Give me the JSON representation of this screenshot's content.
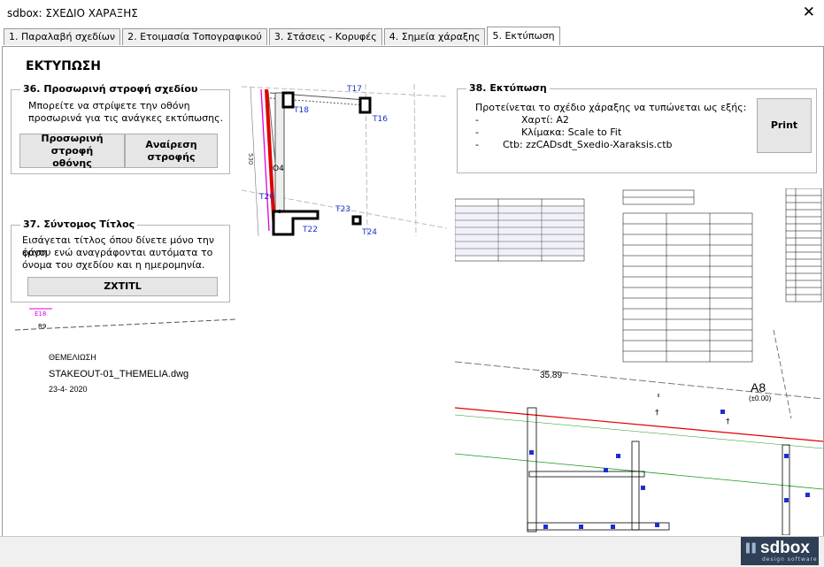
{
  "window": {
    "title": "sdbox:  ΣΧΕΔΙΟ  ΧΑΡΑΞΗΣ",
    "close_glyph": "✕"
  },
  "tabs": [
    {
      "label": "1. Παραλαβή σχεδίων"
    },
    {
      "label": "2. Ετοιμασία Τοπογραφικού"
    },
    {
      "label": "3. Στάσεις - Κορυφές"
    },
    {
      "label": "4. Σημεία χάραξης"
    },
    {
      "label": "5. Εκτύπωση"
    }
  ],
  "active_tab": 4,
  "page": {
    "heading": "ΕΚΤΥΠΩΣΗ"
  },
  "section36": {
    "title": "36. Προσωρινή στροφή σχεδίου",
    "line1": "Μπορείτε να στρίψετε την οθόνη",
    "line2": "προσωρινά για τις ανάγκες εκτύπωσης.",
    "rotate_btn_line1": "Προσωρινή στροφή",
    "rotate_btn_line2": "οθόνης",
    "undo_btn_line1": "Αναίρεση",
    "undo_btn_line2": "στροφής"
  },
  "section37": {
    "title": "37. Σύντομος Τίτλος",
    "line1": "Εισάγεται τίτλος όπου δίνετε μόνο την φάση",
    "line2": "έργου ενώ αναγράφονται αυτόματα το",
    "line3": "όνομα του σχεδίου και η ημερομηνία.",
    "btn": "ZXTITL"
  },
  "section38": {
    "title": "38. Εκτύπωση",
    "intro": "Προτείνεται το σχέδιο χάραξης να τυπώνεται ως εξής:",
    "rows": [
      {
        "dash": "-",
        "text": "Χαρτί: A2"
      },
      {
        "dash": "-",
        "text": "Κλίμακα: Scale to Fit"
      },
      {
        "dash": "-",
        "text": "Ctb: zzCADsdt_Sxedio-Xaraksis.ctb"
      }
    ],
    "print_btn": "Print"
  },
  "stamp": {
    "phase": "ΘΕΜΕΛΙΩΣΗ",
    "filename": "STAKEOUT-01_THEMELIA.dwg",
    "date": "23-4- 2020"
  },
  "drawing1": {
    "labels": [
      "T18",
      "T16",
      "T17",
      "T20",
      "O4",
      "T23",
      "T22",
      "T24",
      "530"
    ],
    "small_labels": [
      "E18",
      "R9"
    ]
  },
  "drawing2": {
    "dim": "35.89",
    "axis_label": "A8",
    "axis_sub": "(±0.00)"
  },
  "brand": {
    "name": "sdbox",
    "sub": "design software",
    "mark": "▌▌"
  },
  "colors": {
    "accent": "#2e3f56",
    "drawing_red": "#e00000",
    "drawing_magenta": "#e000e0",
    "drawing_blue": "#1a2fd0",
    "drawing_green": "#1a9a1a"
  }
}
